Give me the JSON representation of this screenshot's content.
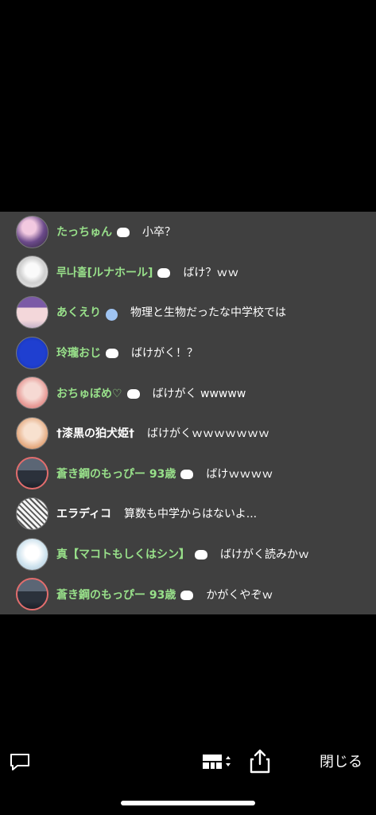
{
  "chat": {
    "messages": [
      {
        "name": "たっちゅん",
        "text": "小卒？"
      },
      {
        "name": "루나홀[ルナホール]",
        "text": "ばけ？ｗｗ"
      },
      {
        "name": "あくえり",
        "text": "物理と生物だったな中学校では"
      },
      {
        "name": "玲瓏おじ",
        "text": "ばけがく！？"
      },
      {
        "name": "おちゅぼめ♡",
        "text": "ばけがく wwwww"
      },
      {
        "name": "†漆黒の狛犬姫†",
        "text": "ばけがくｗｗｗｗｗｗｗ"
      },
      {
        "name": "蒼き鋼のもっぴー 93歳",
        "text": "ばけｗｗｗｗ"
      },
      {
        "name": "エラディコ",
        "text": "算数も中学からはないよ..."
      },
      {
        "name": "真【マコトもしくはシン】",
        "text": "ばけがく読みかｗ"
      },
      {
        "name": "蒼き鋼のもっぴー 93歳",
        "text": "かがくやぞｗ"
      }
    ]
  },
  "toolbar": {
    "close_label": "閉じる"
  },
  "icons": {
    "chat": "chat-bubble-icon",
    "quality": "video-quality-icon",
    "share": "share-icon"
  },
  "colors": {
    "name_green": "#98e08a",
    "panel_bg": "#404040"
  }
}
